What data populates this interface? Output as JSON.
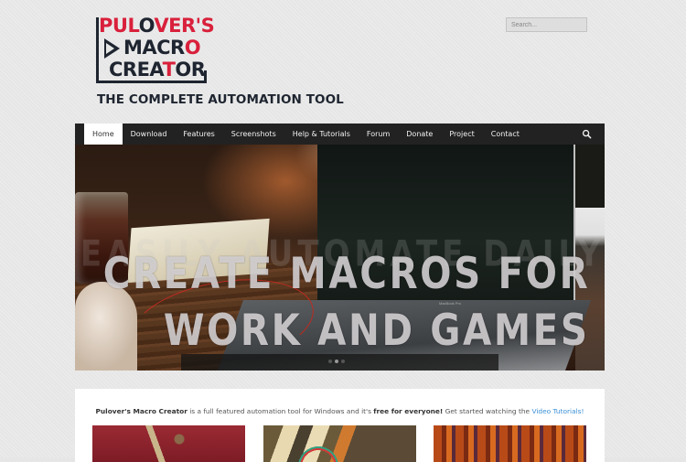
{
  "logo": {
    "line1": [
      "PUL",
      "O",
      "VER'S"
    ],
    "line2": [
      "MACR",
      "O"
    ],
    "line3": [
      "CREA",
      "T",
      "OR"
    ],
    "tagline": "THE COMPLETE AUTOMATION TOOL",
    "colors": {
      "red": "#d9203b",
      "dark": "#1e2530"
    }
  },
  "search": {
    "placeholder": "Search..."
  },
  "nav": {
    "items": [
      {
        "label": "Home",
        "active": true
      },
      {
        "label": "Download"
      },
      {
        "label": "Features"
      },
      {
        "label": "Screenshots"
      },
      {
        "label": "Help & Tutorials"
      },
      {
        "label": "Forum"
      },
      {
        "label": "Donate"
      },
      {
        "label": "Project"
      },
      {
        "label": "Contact"
      }
    ],
    "search_icon": "search-icon"
  },
  "slider": {
    "ghost_text": "EASILY AUTOMATE DAILY TASKS",
    "headline_line1": "CREATE MACROS FOR",
    "headline_line2": "WORK AND GAMES",
    "laptop_label": "MacBook Pro",
    "dots": 3,
    "active_dot": 2
  },
  "intro": {
    "brand": "Pulover's Macro Creator",
    "text1": " is a full featured automation tool for Windows and it's ",
    "free": "free for everyone!",
    "text2": " Get started watching the ",
    "link": "Video Tutorials!",
    "link_color": "#3a8fd6"
  },
  "thumbnails": [
    {
      "name": "thumbnail-bolts"
    },
    {
      "name": "thumbnail-darts"
    },
    {
      "name": "thumbnail-arcade"
    }
  ]
}
